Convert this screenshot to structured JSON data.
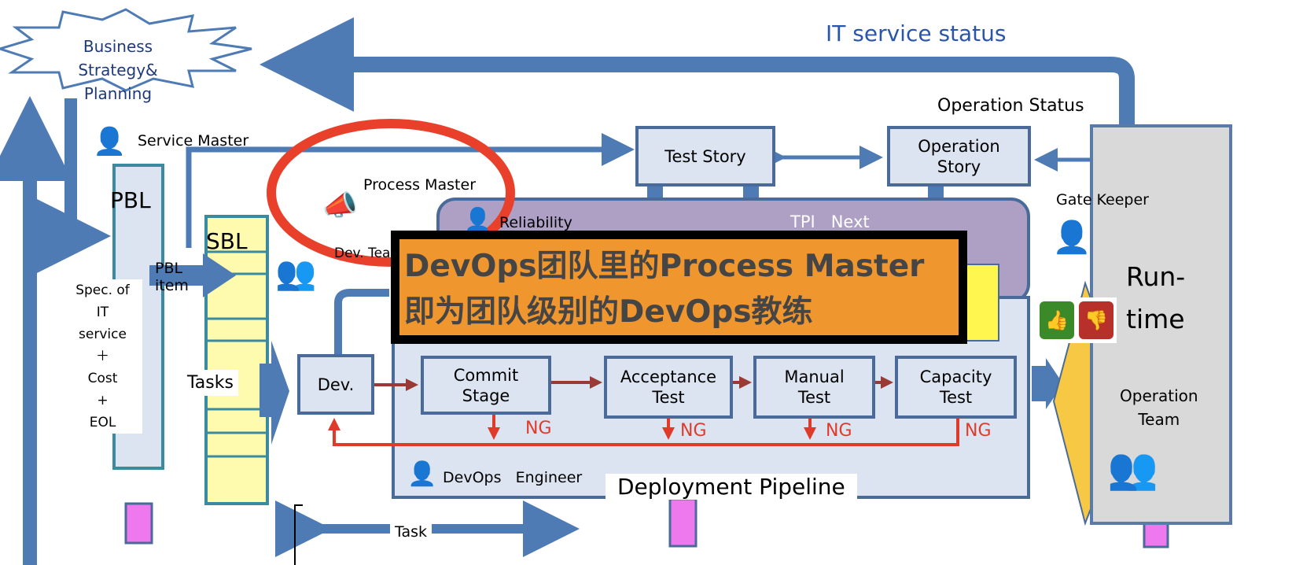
{
  "title_overlay": {
    "line1": "DevOps团队里的Process Master",
    "line2": "即为团队级别的DevOps教练"
  },
  "labels": {
    "business_strategy": [
      "Business",
      "Strategy&",
      "Planning"
    ],
    "it_service_status": "IT service status",
    "operation_status": "Operation Status",
    "service_master": "Service Master",
    "process_master": "Process Master",
    "pbl": "PBL",
    "sbl": "SBL",
    "pbl_item": [
      "PBL",
      "item"
    ],
    "spec": [
      "Spec. of",
      "IT",
      "service",
      "＋",
      "Cost",
      "+",
      "EOL"
    ],
    "tasks": "Tasks",
    "dev_team": "Dev. Team",
    "reliability": "Reliability",
    "tpi_next": "TPI   Next",
    "gate_keeper": "Gate Keeper",
    "runtime": [
      "Run-",
      "time"
    ],
    "operation_team": [
      "Operation",
      "Team"
    ],
    "devops_engineer": "DevOps   Engineer",
    "deployment_pipeline": "Deployment Pipeline",
    "task": "Task",
    "ng": "NG"
  },
  "boxes": {
    "test_story": "Test Story",
    "operation_story": [
      "Operation",
      "Story"
    ],
    "dev": "Dev.",
    "commit_stage": [
      "Commit",
      "Stage"
    ],
    "acceptance_test": [
      "Acceptance",
      "Test"
    ],
    "manual_test": [
      "Manual",
      "Test"
    ],
    "capacity_test": [
      "Capacity",
      "Test"
    ]
  },
  "icons": [
    "person-icon",
    "megaphone-person-icon",
    "team-icon",
    "thumbs-up-icon",
    "thumbs-down-icon"
  ],
  "colors": {
    "arrow_blue": "#4f7bb5",
    "highlight_red": "#e8402a",
    "overlay_orange": "#f0962f",
    "ng_red": "#e03a2a",
    "purple": "#ada0c4",
    "pipeline_bg": "#dbe4f0"
  }
}
